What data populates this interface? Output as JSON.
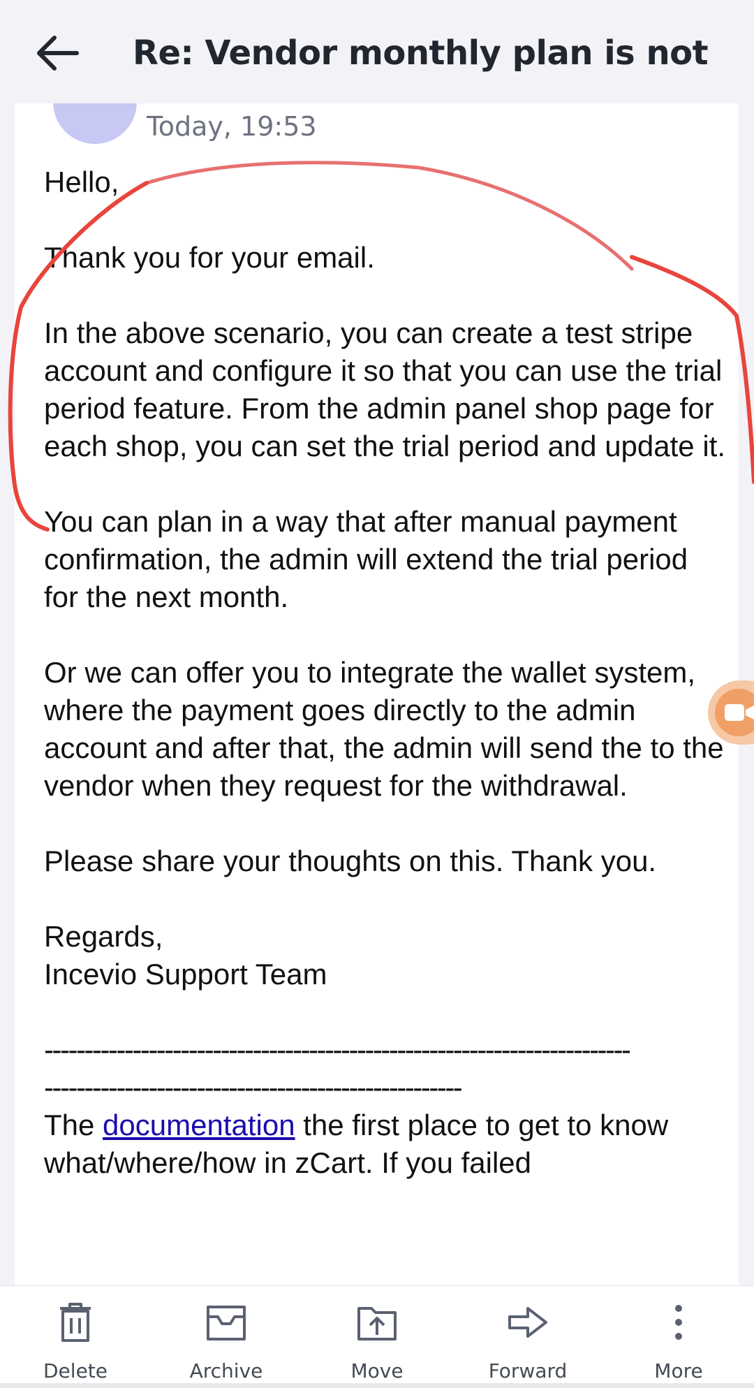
{
  "header": {
    "title": "Re: Vendor monthly plan is not w..."
  },
  "email": {
    "timestamp": "Today, 19:53",
    "greeting": "Hello,",
    "p1": "Thank you for your email.",
    "p2": "In the above scenario, you can create a test stripe account and configure it so that you can use the trial period feature. From the admin panel shop page for each shop, you can set the trial period and update it.",
    "p3": "You can plan in a way that after manual payment confirmation, the admin will extend the trial period for the next month.",
    "p4": "Or we can offer you to integrate the wallet system, where the payment goes directly to the admin account and after that, the admin will send the to the vendor when they request for the withdrawal.",
    "p5": "Please share your thoughts on this. Thank you.",
    "regards": "Regards,",
    "signature": "Incevio Support Team",
    "dashes1": "-------------------------------------------------------------------------",
    "dashes2": "----------------------------------------------------",
    "footer_prefix": "The ",
    "footer_link": "documentation",
    "footer_suffix": " the first place to get to know what/where/how in zCart. If you failed"
  },
  "toolbar": {
    "delete": "Delete",
    "archive": "Archive",
    "move": "Move",
    "forward": "Forward",
    "more": "More"
  },
  "colors": {
    "annotation": "#e8453c",
    "link": "#1a0dab",
    "float_button": "#f0a066"
  }
}
